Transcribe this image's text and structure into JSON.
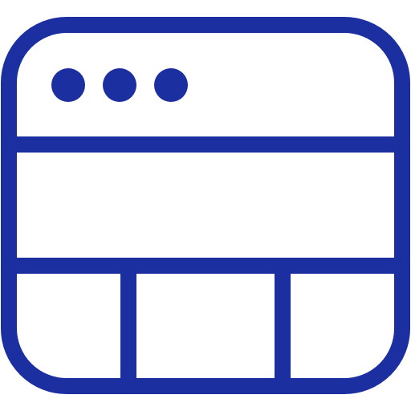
{
  "icon": {
    "name": "browser-window-layout-icon",
    "color": "#1b2fa0",
    "background": "#ffffff"
  }
}
